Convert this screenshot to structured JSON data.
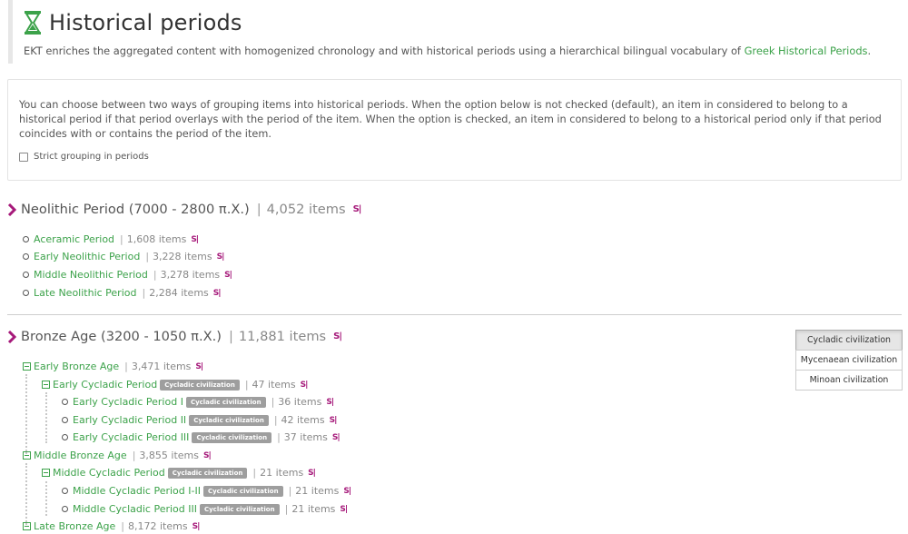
{
  "header": {
    "title": "Historical periods",
    "intro_text": "EKT enriches the aggregated content with homogenized chronology and with historical periods using a hierarchical bilingual vocabulary of ",
    "intro_link": "Greek Historical Periods",
    "intro_end": "."
  },
  "info": {
    "text": "You can choose between two ways of grouping items into historical periods. When the option below is not checked (default), an item in considered to belong to a historical period if that period overlays with the period of the item. When the option is checked, an item in considered to belong to a historical period only if that period coincides with or contains the period of the item.",
    "checkbox_label": "Strict grouping in periods",
    "checked": false
  },
  "neolithic": {
    "title": "Neolithic Period (7000 - 2800 π.Χ.)",
    "count": "4,052 items",
    "children": [
      {
        "label": "Aceramic Period",
        "count": "1,608 items"
      },
      {
        "label": "Early Neolithic Period",
        "count": "3,228 items"
      },
      {
        "label": "Middle Neolithic Period",
        "count": "3,278 items"
      },
      {
        "label": "Late Neolithic Period",
        "count": "2,284 items"
      }
    ]
  },
  "bronze": {
    "title": "Bronze Age (3200 - 1050 π.Χ.)",
    "count": "11,881 items",
    "tree": [
      {
        "label": "Early Bronze Age",
        "count": "3,471 items"
      },
      {
        "label": "Early Cycladic Period",
        "badge": "Cycladic civilization",
        "count": "47 items"
      },
      {
        "label": "Early Cycladic Period I",
        "badge": "Cycladic civilization",
        "count": "36 items"
      },
      {
        "label": "Early Cycladic Period II",
        "badge": "Cycladic civilization",
        "count": "42 items"
      },
      {
        "label": "Early Cycladic Period III",
        "badge": "Cycladic civilization",
        "count": "37 items"
      },
      {
        "label": "Middle Bronze Age",
        "count": "3,855 items"
      },
      {
        "label": "Middle Cycladic Period",
        "badge": "Cycladic civilization",
        "count": "21 items"
      },
      {
        "label": "Middle Cycladic Period I-II",
        "badge": "Cycladic civilization",
        "count": "21 items"
      },
      {
        "label": "Middle Cycladic Period III",
        "badge": "Cycladic civilization",
        "count": "21 items"
      },
      {
        "label": "Late Bronze Age",
        "count": "8,172 items"
      }
    ]
  },
  "filters": {
    "options": [
      "Cycladic civilization",
      "Mycenaean civilization",
      "Minoan civilization"
    ],
    "active": "Cycladic civilization"
  },
  "separator": "|",
  "search_icon": "S|",
  "colors": {
    "accent": "#3ca24a",
    "chevron": "#a6197a",
    "badge": "#9e9e9e"
  }
}
